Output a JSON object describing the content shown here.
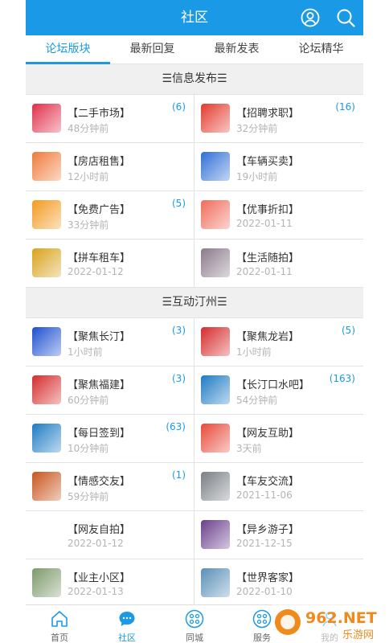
{
  "header": {
    "title": "社区"
  },
  "tabs": [
    {
      "label": "论坛版块",
      "active": true
    },
    {
      "label": "最新回复",
      "active": false
    },
    {
      "label": "最新发表",
      "active": false
    },
    {
      "label": "论坛精华",
      "active": false
    }
  ],
  "sections": [
    {
      "title": "☰信息发布☰",
      "items": [
        {
          "name": "【二手市场】",
          "time": "48分钟前",
          "count": "(6)",
          "icon": "shopping-basket-icon",
          "color": "#e0304a"
        },
        {
          "name": "【招聘求职】",
          "time": "32分钟前",
          "count": "(16)",
          "icon": "recruit-icon",
          "color": "#e23b2e"
        },
        {
          "name": "【房店租售】",
          "time": "12小时前",
          "count": "",
          "icon": "house-icon",
          "color": "#f07a3a"
        },
        {
          "name": "【车辆买卖】",
          "time": "19小时前",
          "count": "",
          "icon": "car-icon",
          "color": "#2f6fd6"
        },
        {
          "name": "【免费广告】",
          "time": "33分钟前",
          "count": "(5)",
          "icon": "ad-icon",
          "color": "#f39a1e"
        },
        {
          "name": "【优事折扣】",
          "time": "2022-01-11",
          "count": "",
          "icon": "discount-icon",
          "color": "#f06c5a"
        },
        {
          "name": "【拼车租车】",
          "time": "2022-01-12",
          "count": "",
          "icon": "carpool-icon",
          "color": "#d9a21a"
        },
        {
          "name": "【生活随拍】",
          "time": "2022-01-11",
          "count": "",
          "icon": "photo-icon",
          "color": "#8a7a8a"
        }
      ]
    },
    {
      "title": "☰互动汀州☰",
      "items": [
        {
          "name": "【聚焦长汀】",
          "time": "1小时前",
          "count": "(3)",
          "icon": "starburst-icon",
          "color": "#1c4fd0"
        },
        {
          "name": "【聚焦龙岩】",
          "time": "1小时前",
          "count": "(5)",
          "icon": "stamp-icon",
          "color": "#d62b2b"
        },
        {
          "name": "【聚焦福建】",
          "time": "60分钟前",
          "count": "(3)",
          "icon": "stamp-icon",
          "color": "#d62b2b"
        },
        {
          "name": "【长汀口水吧】",
          "time": "54分钟前",
          "count": "(163)",
          "icon": "water-drop-icon",
          "color": "#1d7bc4"
        },
        {
          "name": "【每日签到】",
          "time": "10分钟前",
          "count": "(63)",
          "icon": "water-drop-icon",
          "color": "#1d7bc4"
        },
        {
          "name": "【网友互助】",
          "time": "3天前",
          "count": "",
          "icon": "people-icon",
          "color": "#e84a3a"
        },
        {
          "name": "【情感交友】",
          "time": "59分钟前",
          "count": "(1)",
          "icon": "silhouette-icon",
          "color": "#c9541c"
        },
        {
          "name": "【车友交流】",
          "time": "2021-11-06",
          "count": "",
          "icon": "car-icon",
          "color": "#7a7f86"
        },
        {
          "name": "【网友自拍】",
          "time": "2022-01-12",
          "count": "",
          "icon": "none",
          "color": "#ffffff"
        },
        {
          "name": "【异乡游子】",
          "time": "2021-12-15",
          "count": "",
          "icon": "sunset-icon",
          "color": "#6a3f8c"
        },
        {
          "name": "【业主小区】",
          "time": "2022-01-13",
          "count": "",
          "icon": "buildings-icon",
          "color": "#7b9a6a"
        },
        {
          "name": "【世界客家】",
          "time": "2022-01-10",
          "count": "",
          "icon": "statue-icon",
          "color": "#5a8fb8"
        }
      ]
    }
  ],
  "tabbar": [
    {
      "label": "首页",
      "icon": "home-icon",
      "active": false
    },
    {
      "label": "社区",
      "icon": "chat-bubble-icon",
      "active": true
    },
    {
      "label": "同城",
      "icon": "grid-circle-icon",
      "active": false
    },
    {
      "label": "服务",
      "icon": "grid-circle-icon",
      "active": false
    },
    {
      "label": "我的",
      "icon": "user-icon",
      "active": false
    }
  ],
  "watermark": {
    "brand": "962.NET",
    "subtitle": "乐游网"
  },
  "colors": {
    "accent": "#1a9ae6",
    "count": "#1a9ae6",
    "time": "#b4b4b4",
    "background": "#f0f0f0"
  }
}
